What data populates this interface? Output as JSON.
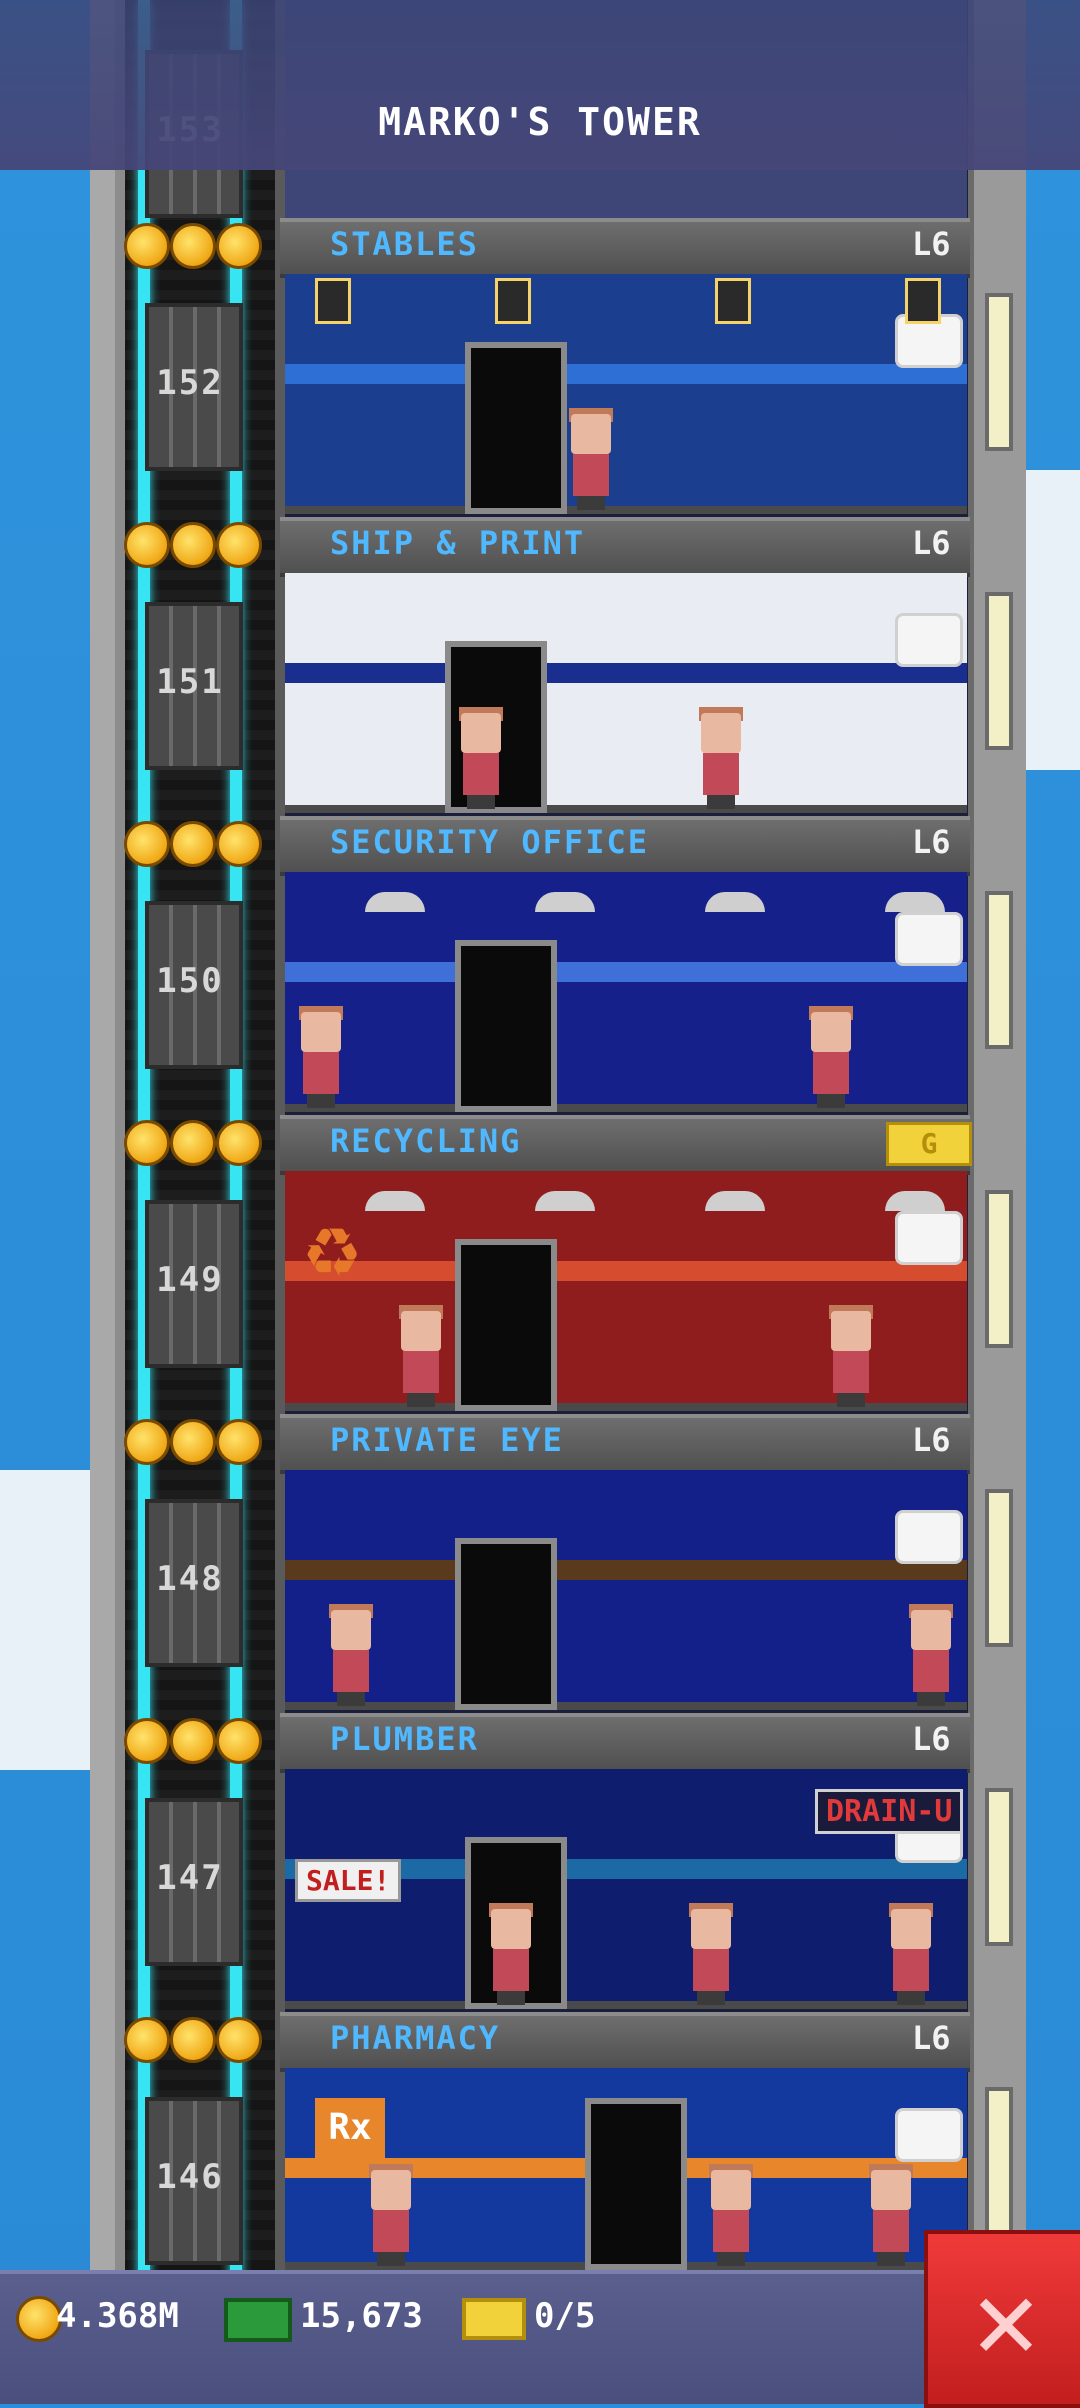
{
  "header": {
    "title": "MARKO'S TOWER",
    "top_floor_number": "153"
  },
  "floors": [
    {
      "number": "152",
      "name": "STABLES",
      "level": "L6",
      "room_color": "#1b3e8f",
      "accent": "#2e6fd6"
    },
    {
      "number": "151",
      "name": "SHIP & PRINT",
      "level": "L6",
      "room_color": "#e9ecf3",
      "accent": "#1a2e8f"
    },
    {
      "number": "150",
      "name": "SECURITY OFFICE",
      "level": "L6",
      "room_color": "#15208a",
      "accent": "#3f6fd8"
    },
    {
      "number": "149",
      "name": "RECYCLING",
      "level": "",
      "room_color": "#8f1d1d",
      "accent": "#d64c2e",
      "badge": "G"
    },
    {
      "number": "148",
      "name": "PRIVATE EYE",
      "level": "L6",
      "room_color": "#13208a",
      "accent": "#5a3a1c"
    },
    {
      "number": "147",
      "name": "PLUMBER",
      "level": "L6",
      "room_color": "#0f1d6e",
      "accent": "#1b6aa6",
      "signs": [
        "DRAIN-U",
        "SALE!"
      ]
    },
    {
      "number": "146",
      "name": "PHARMACY",
      "level": "L6",
      "room_color": "#14399e",
      "accent": "#e7862a",
      "signs": [
        "Rx"
      ]
    }
  ],
  "status_bar": {
    "coins": "4.368M",
    "bux": "15,673",
    "tickets": "0/5"
  },
  "icons": {
    "coin": "coin-icon",
    "bux": "bux-icon",
    "ticket": "ticket-icon",
    "close": "close-icon"
  }
}
